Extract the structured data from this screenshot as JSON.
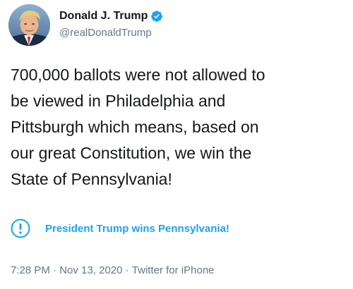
{
  "author": {
    "display_name": "Donald J. Trump",
    "handle": "@realDonaldTrump",
    "verified": true
  },
  "tweet": {
    "text": "700,000 ballots were not allowed to\nbe viewed in Philadelphia and\nPittsburgh which means, based on\nour great Constitution, we win the\nState of Pennsylvania!"
  },
  "notice": {
    "icon": "exclamation-circle-icon",
    "label": "President Trump wins Pennsylvania!"
  },
  "meta": {
    "time": "7:28 PM",
    "separator": " · ",
    "date": "Nov 13, 2020",
    "source": "Twitter for iPhone"
  },
  "colors": {
    "accent": "#1da1f2",
    "text": "#14171a",
    "muted": "#657786"
  }
}
